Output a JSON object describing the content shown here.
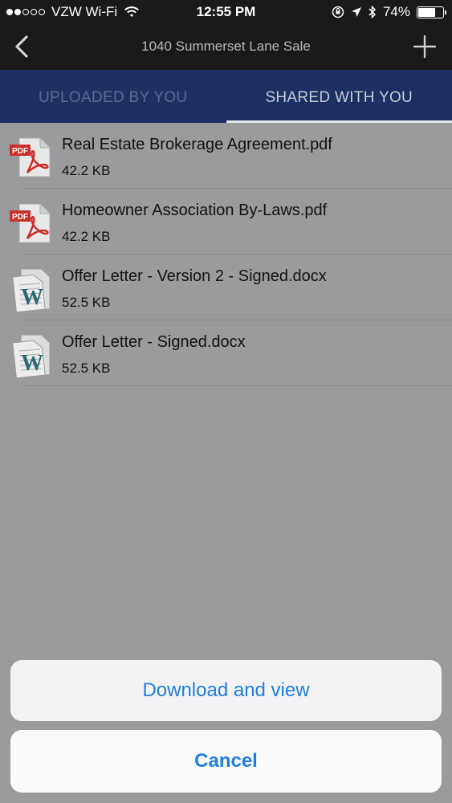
{
  "status_bar": {
    "carrier": "VZW Wi-Fi",
    "time": "12:55 PM",
    "battery_percent": "74%",
    "battery_level": 0.74,
    "signal_bars_filled": 2,
    "signal_bars_total": 5
  },
  "nav": {
    "title": "1040 Summerset Lane Sale",
    "back_icon": "chevron-left-icon",
    "add_icon": "plus-icon"
  },
  "tabs": [
    {
      "label": "UPLOADED BY YOU",
      "active": false
    },
    {
      "label": "SHARED WITH YOU",
      "active": true
    }
  ],
  "files": [
    {
      "name": "Real Estate Brokerage Agreement.pdf",
      "size": "42.2 KB",
      "type": "pdf"
    },
    {
      "name": "Homeowner Association By-Laws.pdf",
      "size": "42.2 KB",
      "type": "pdf"
    },
    {
      "name": "Offer Letter - Version 2 - Signed.docx",
      "size": "52.5 KB",
      "type": "docx"
    },
    {
      "name": "Offer Letter - Signed.docx",
      "size": "52.5 KB",
      "type": "docx"
    }
  ],
  "action_sheet": {
    "primary_label": "Download and view",
    "cancel_label": "Cancel"
  },
  "colors": {
    "tab_bar": "#1d2f63",
    "action_text": "#1f7ee0",
    "dim_overlay": "#9b9b9d"
  }
}
